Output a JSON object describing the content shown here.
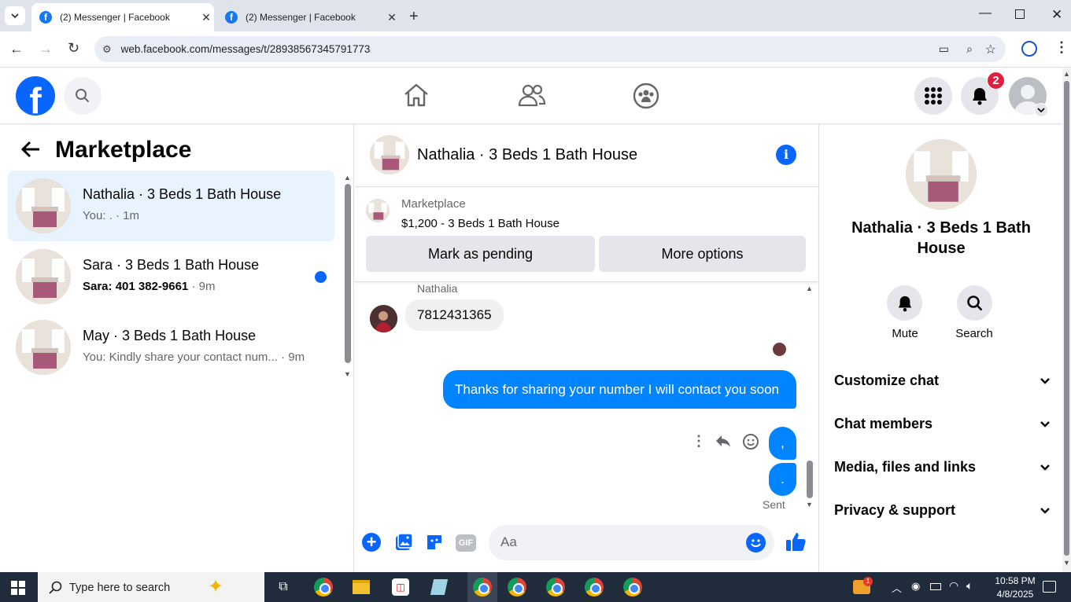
{
  "browser": {
    "tabs": [
      {
        "title": "(2) Messenger | Facebook",
        "active": true
      },
      {
        "title": "(2) Messenger | Facebook",
        "active": false
      }
    ],
    "url": "web.facebook.com/messages/t/28938567345791773"
  },
  "header": {
    "notification_count": "2"
  },
  "left": {
    "title": "Marketplace",
    "conversations": [
      {
        "name": "Nathalia · 3 Beds 1 Bath House",
        "preview": "You: . · 1m",
        "selected": true,
        "unread": false
      },
      {
        "name": "Sara · 3 Beds 1 Bath House",
        "preview_bold": "Sara: 401 382-9661",
        "preview_time": " · 9m",
        "selected": false,
        "unread": true
      },
      {
        "name": "May · 3 Beds 1 Bath House",
        "preview": "You: Kindly share your contact num...",
        "preview_time": " · 9m",
        "selected": false,
        "unread": false
      }
    ]
  },
  "chat": {
    "title": "Nathalia · 3 Beds 1 Bath House",
    "listing": {
      "label": "Marketplace",
      "price_title": "$1,200 - 3 Beds 1 Bath House",
      "mark_pending": "Mark as pending",
      "more_options": "More options"
    },
    "messages": {
      "sender_name": "Nathalia",
      "incoming": "7812431365",
      "outgoing_1": "Thanks for sharing your number I will contact you soon",
      "outgoing_2": ",",
      "outgoing_3": ".",
      "status": "Sent"
    },
    "composer": {
      "placeholder": "Aa",
      "gif_label": "GIF"
    }
  },
  "info": {
    "name": "Nathalia · 3 Beds 1 Bath House",
    "mute_label": "Mute",
    "search_label": "Search",
    "sections": [
      "Customize chat",
      "Chat members",
      "Media, files and links",
      "Privacy & support"
    ]
  },
  "taskbar": {
    "search_placeholder": "Type here to search",
    "time": "10:58 PM",
    "date": "4/8/2025",
    "weather_badge": "1"
  },
  "colors": {
    "fb_blue": "#0866ff",
    "messenger_blue": "#0084ff",
    "notification_red": "#e41e3f"
  }
}
